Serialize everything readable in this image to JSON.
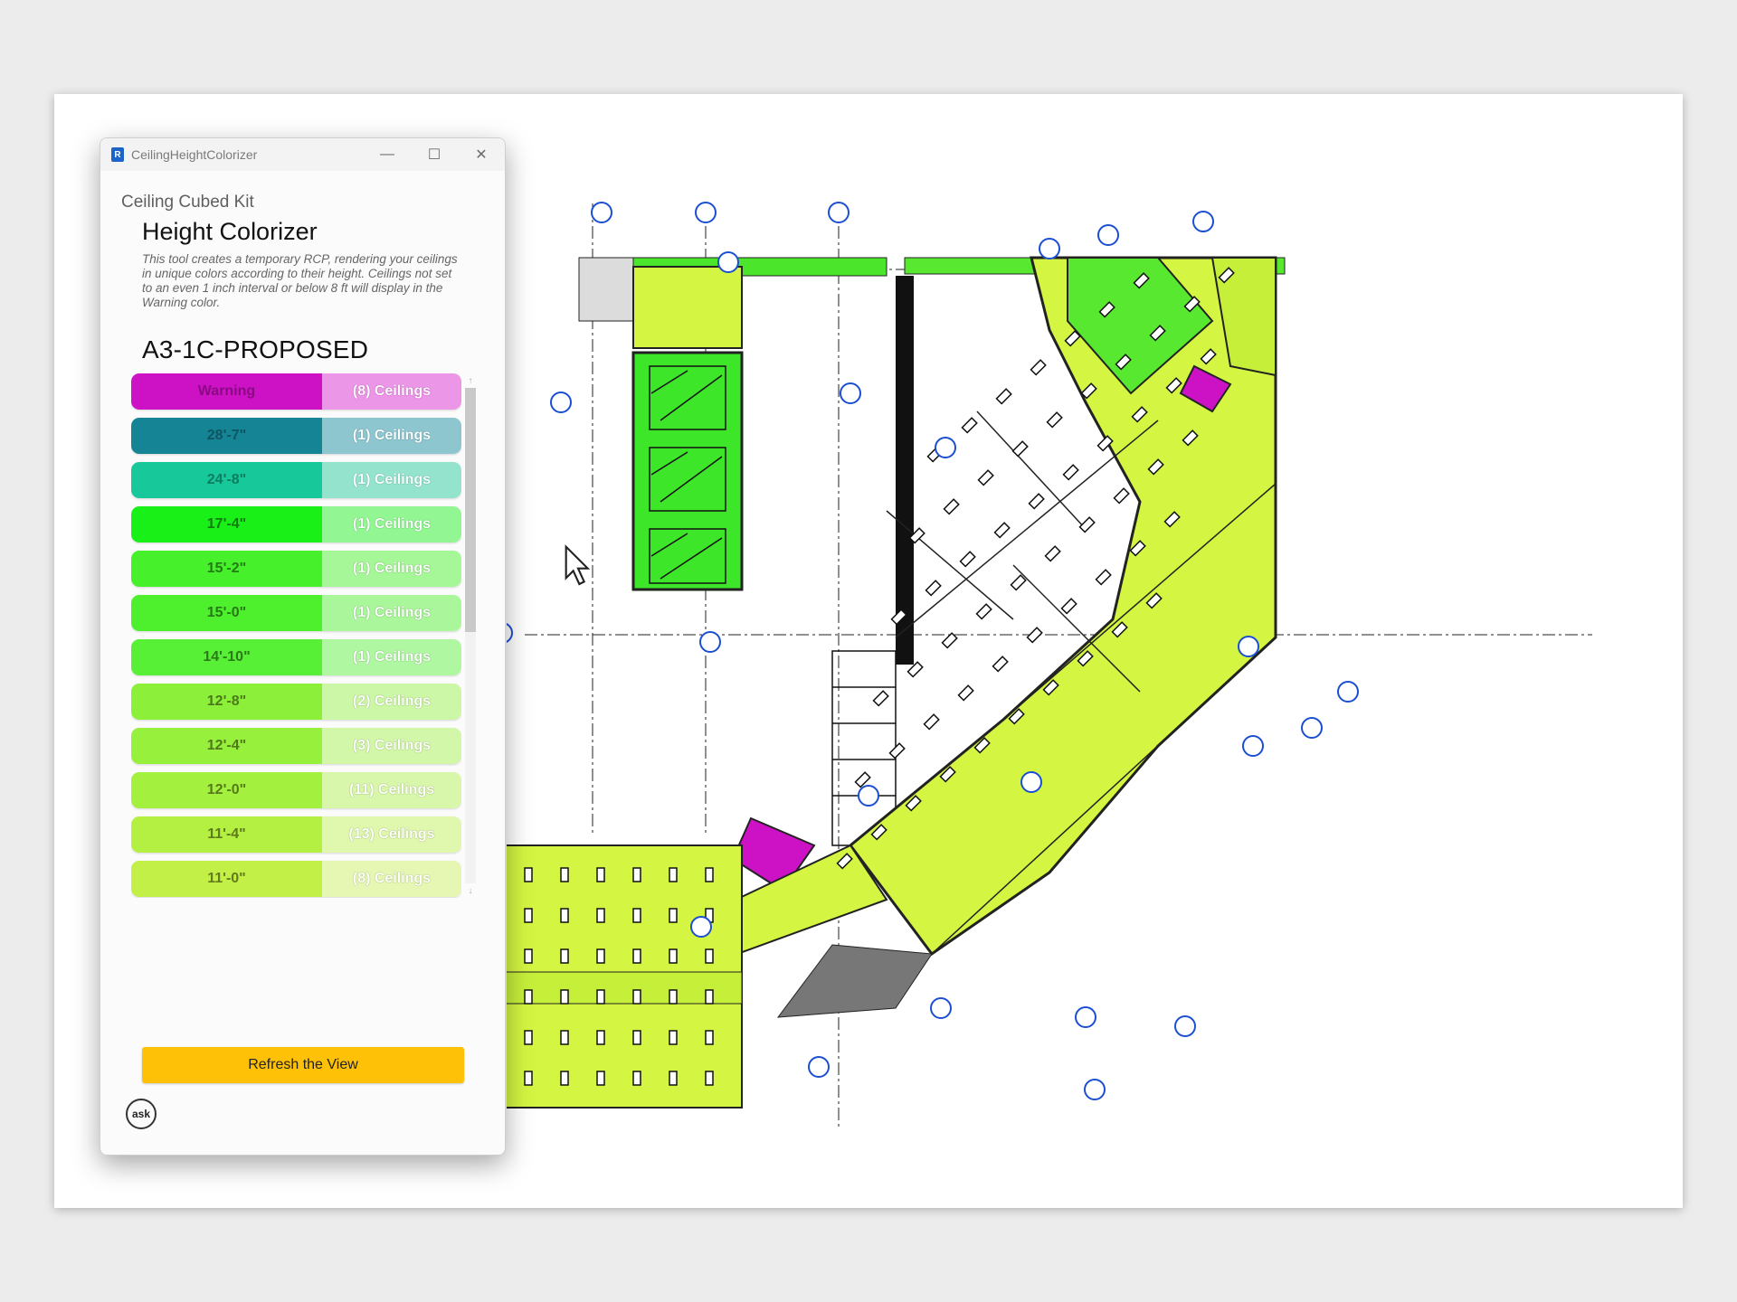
{
  "window": {
    "title": "CeilingHeightColorizer",
    "app_icon": "R",
    "controls": {
      "minimize": "—",
      "maximize": "☐",
      "close": "✕"
    }
  },
  "header": {
    "kit": "Ceiling Cubed Kit",
    "title": "Height Colorizer",
    "description": "This tool creates a temporary RCP, rendering your ceilings in unique colors according to their height. Ceilings not set to an even 1 inch interval or below 8 ft will display in the Warning color."
  },
  "view_name": "A3-1C-PROPOSED",
  "heights": [
    {
      "label": "Warning",
      "count": "(8) Ceilings",
      "color": "#cc12c4",
      "light": "#eb96e6",
      "text": "#8a0a84"
    },
    {
      "label": "28'-7\"",
      "count": "(1) Ceilings",
      "color": "#158596",
      "light": "#8ec6cf",
      "text": "#0d5561"
    },
    {
      "label": "24'-8\"",
      "count": "(1) Ceilings",
      "color": "#16c89a",
      "light": "#94e3cd",
      "text": "#0d7d60"
    },
    {
      "label": "17'-4\"",
      "count": "(1) Ceilings",
      "color": "#18f018",
      "light": "#92f792",
      "text": "#0f7d0f"
    },
    {
      "label": "15'-2\"",
      "count": "(1) Ceilings",
      "color": "#46f02a",
      "light": "#a6f797",
      "text": "#247a14"
    },
    {
      "label": "15'-0\"",
      "count": "(1) Ceilings",
      "color": "#4ef02e",
      "light": "#aaf79b",
      "text": "#267a15"
    },
    {
      "label": "14'-10\"",
      "count": "(1) Ceilings",
      "color": "#58f036",
      "light": "#b0f7a2",
      "text": "#2a7a18"
    },
    {
      "label": "12'-8\"",
      "count": "(2) Ceilings",
      "color": "#8cf03a",
      "light": "#ccf7a6",
      "text": "#4a7a18"
    },
    {
      "label": "12'-4\"",
      "count": "(3) Ceilings",
      "color": "#96f03c",
      "light": "#d2f7a8",
      "text": "#4e7a1a"
    },
    {
      "label": "12'-0\"",
      "count": "(11) Ceilings",
      "color": "#a4f03e",
      "light": "#d8f7aa",
      "text": "#557a1a"
    },
    {
      "label": "11'-4\"",
      "count": "(13) Ceilings",
      "color": "#b4f042",
      "light": "#e0f7ae",
      "text": "#5d7a1c"
    },
    {
      "label": "11'-0\"",
      "count": "(8) Ceilings",
      "color": "#c2f046",
      "light": "#e5f7b2",
      "text": "#647a1c"
    }
  ],
  "scroll": {
    "up": "↑",
    "down": "↓"
  },
  "refresh_label": "Refresh the View",
  "ask_label": "ask",
  "plan_colors": {
    "main": "#d4f542",
    "bright": "#3ee62a",
    "magenta": "#cc12c4",
    "line": "#1a1a1a",
    "tag": "#1a4fd1"
  }
}
